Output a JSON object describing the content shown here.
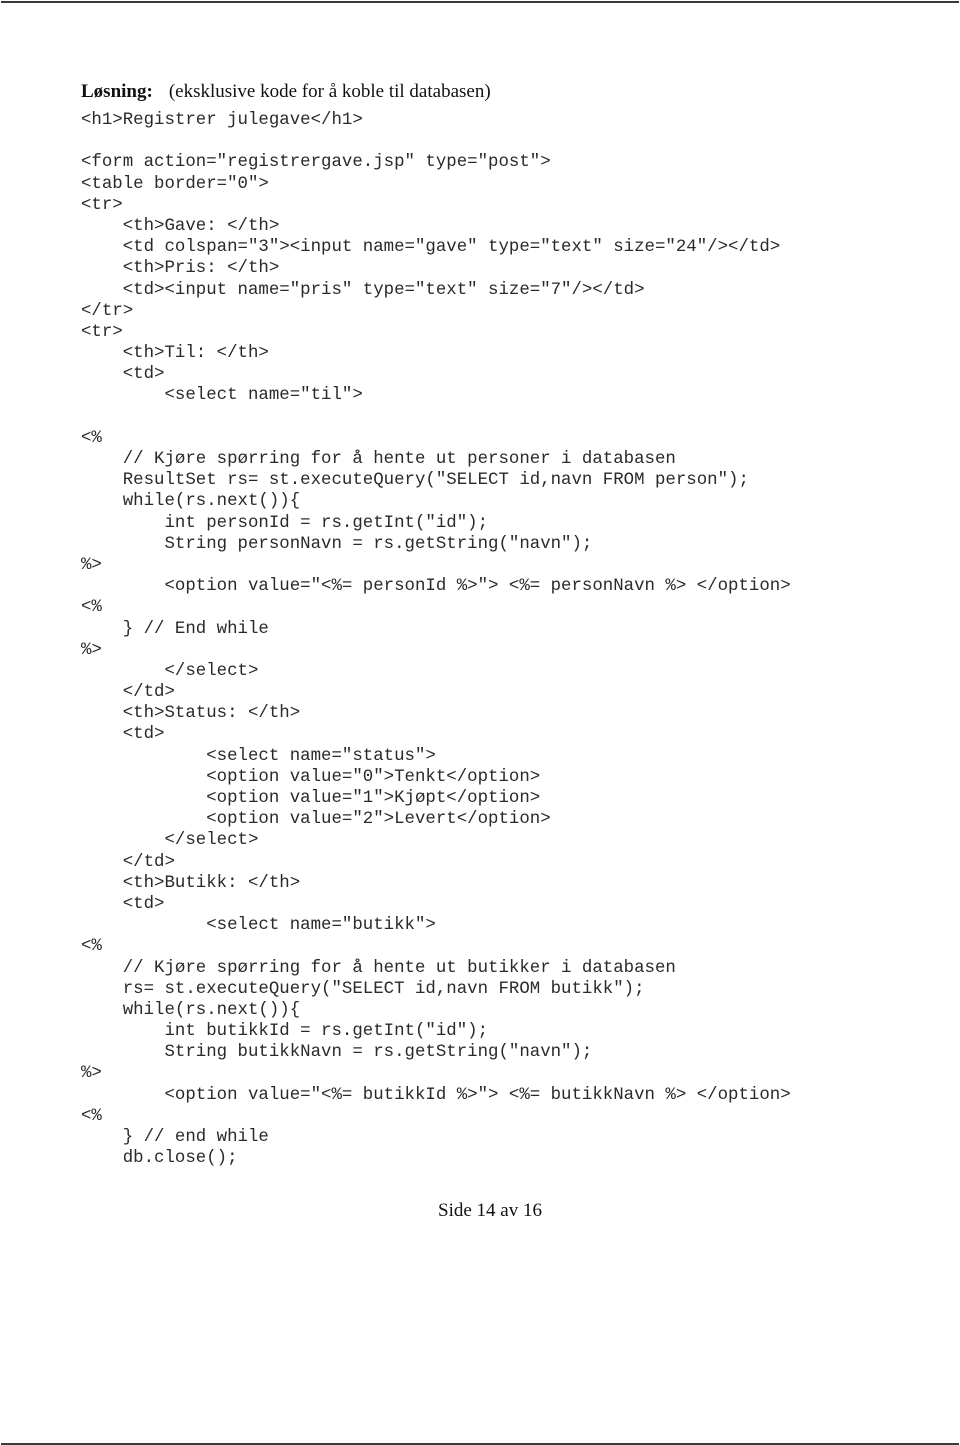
{
  "heading": {
    "label": "Løsning:",
    "note": "(eksklusive kode for å koble til databasen)"
  },
  "code_lines": [
    "<h1>Registrer julegave</h1>",
    "",
    "<form action=\"registrergave.jsp\" type=\"post\">",
    "<table border=\"0\">",
    "<tr>",
    "    <th>Gave: </th>",
    "    <td colspan=\"3\"><input name=\"gave\" type=\"text\" size=\"24\"/></td>",
    "    <th>Pris: </th>",
    "    <td><input name=\"pris\" type=\"text\" size=\"7\"/></td>",
    "</tr>",
    "<tr>",
    "    <th>Til: </th>",
    "    <td>",
    "        <select name=\"til\">",
    "",
    "<%",
    "    // Kjøre spørring for å hente ut personer i databasen",
    "    ResultSet rs= st.executeQuery(\"SELECT id,navn FROM person\");",
    "    while(rs.next()){",
    "        int personId = rs.getInt(\"id\");",
    "        String personNavn = rs.getString(\"navn\");",
    "%>",
    "        <option value=\"<%= personId %>\"> <%= personNavn %> </option>",
    "<%",
    "    } // End while",
    "%>",
    "        </select>",
    "    </td>",
    "    <th>Status: </th>",
    "    <td>",
    "            <select name=\"status\">",
    "            <option value=\"0\">Tenkt</option>",
    "            <option value=\"1\">Kjøpt</option>",
    "            <option value=\"2\">Levert</option>",
    "        </select>",
    "    </td>",
    "    <th>Butikk: </th>",
    "    <td>",
    "            <select name=\"butikk\">",
    "<%",
    "    // Kjøre spørring for å hente ut butikker i databasen",
    "    rs= st.executeQuery(\"SELECT id,navn FROM butikk\");",
    "    while(rs.next()){",
    "        int butikkId = rs.getInt(\"id\");",
    "        String butikkNavn = rs.getString(\"navn\");",
    "%>",
    "        <option value=\"<%= butikkId %>\"> <%= butikkNavn %> </option>",
    "<%",
    "    } // end while",
    "    db.close();"
  ],
  "footer": {
    "page_label": "Side 14 av 16"
  }
}
